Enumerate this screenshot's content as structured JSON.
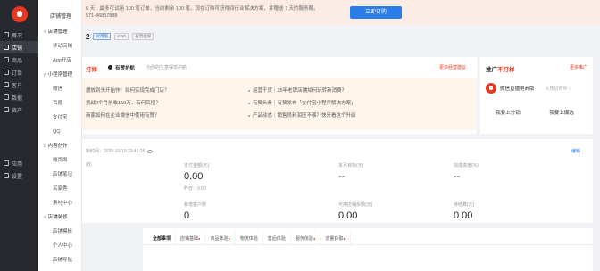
{
  "primary_nav": [
    {
      "label": "概况",
      "icon": "overview-icon"
    },
    {
      "label": "店铺",
      "icon": "shop-icon",
      "active": true
    },
    {
      "label": "商品",
      "icon": "goods-icon"
    },
    {
      "label": "订单",
      "icon": "order-icon"
    },
    {
      "label": "客户",
      "icon": "customer-icon"
    },
    {
      "label": "数据",
      "icon": "data-icon"
    },
    {
      "label": "资产",
      "icon": "asset-icon"
    }
  ],
  "primary_nav_bottom": [
    {
      "label": "应用",
      "icon": "apps-icon"
    },
    {
      "label": "设置",
      "icon": "settings-icon"
    }
  ],
  "secondary_nav": {
    "title": "店铺管理",
    "items": [
      {
        "label": "店铺管理",
        "group": true
      },
      {
        "label": "移动店铺"
      },
      {
        "label": "App开店"
      },
      {
        "label": "小程序管理",
        "group": true
      },
      {
        "label": "微信"
      },
      {
        "label": "百度"
      },
      {
        "label": "支付宝"
      },
      {
        "label": "QQ"
      },
      {
        "label": "内容创作",
        "group": true
      },
      {
        "label": "微页面"
      },
      {
        "label": "店铺笔记"
      },
      {
        "label": "买家秀"
      },
      {
        "label": "素材中心"
      },
      {
        "label": "店铺装修",
        "group": true
      },
      {
        "label": "店铺模板"
      },
      {
        "label": "个人中心"
      },
      {
        "label": "店铺导航"
      }
    ]
  },
  "banner": {
    "line1": "6 天，最多可试用 100 笔订单，当前剩余 100 笔，现在订购可获得四行业解决方案，并赠送 7 天的服务期。",
    "line2": "571-86857888",
    "button": "立即订购"
  },
  "shop": {
    "number": "2",
    "tags": [
      "试用版",
      "SVIP",
      "有赞担保"
    ]
  },
  "card_main": {
    "title": "打样",
    "sub_title": "有赞护航",
    "sub_desc": "为你的生意保驾护航",
    "link": "更多经营建议",
    "left_items": [
      "摆放到头开始作！如何实现完成门店？",
      "挑战0个月创收150万，有何高招？",
      "商家如何在企业微信中使用有赞？"
    ],
    "right_items": [
      "运营干货｜25年老牌店铺如何玩转新消费？",
      "有赞头条｜有赞发布「支付宝小程序解决方案」",
      "产品动态｜销售员利润压不够？快来看这个升级"
    ]
  },
  "card_promo": {
    "title_prefix": "推广",
    "title_accent": "不打样",
    "more": "更多推广",
    "row_name": "微信直播电商版",
    "row_hint": "火热招商中 ›",
    "btn_left": "我要上分销",
    "btn_right": "我要上爆选"
  },
  "stats": {
    "time_label": "新时间：2020-10-10 23:41:25",
    "edit": "编辑",
    "metrics": [
      {
        "label": "支付金额(元)",
        "value": "0.00",
        "sub": "昨日：0.00"
      },
      {
        "label": "本月目标(元)",
        "value": "--",
        "sub": ""
      },
      {
        "label": "完成进度(%)",
        "value": "--",
        "sub": ""
      },
      {
        "label": "新增客户数",
        "value": "0",
        "sub": ""
      },
      {
        "label": "可用店铺余额(元)",
        "value": "0.00",
        "sub": ""
      },
      {
        "label": "待结算(元)",
        "value": "0.00",
        "sub": ""
      }
    ],
    "left_label": "(B)"
  },
  "tabs": [
    {
      "label": "全部事项",
      "active": true,
      "hot": false
    },
    {
      "label": "店铺基础",
      "hot": true
    },
    {
      "label": "商品体验",
      "hot": true
    },
    {
      "label": "物流体验",
      "hot": false
    },
    {
      "label": "售后体验",
      "hot": false
    },
    {
      "label": "服务体验",
      "hot": true
    },
    {
      "label": "流量获取",
      "hot": true
    }
  ]
}
